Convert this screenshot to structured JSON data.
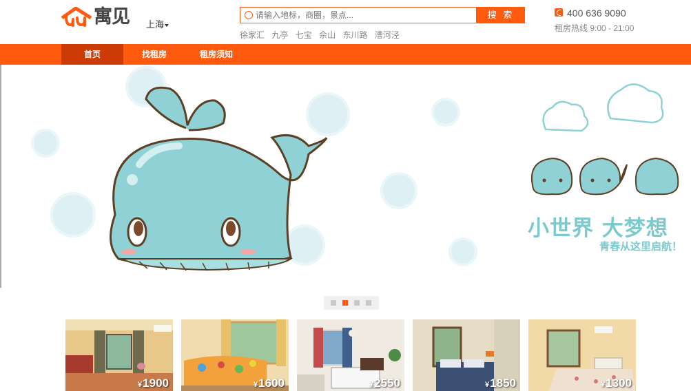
{
  "brand": {
    "name": "寓见",
    "accent": "#ff5a0e"
  },
  "header": {
    "city": "上海",
    "search": {
      "placeholder": "请输入地标，商圈，景点...",
      "button": "搜 索"
    },
    "hot_links": [
      "徐家汇",
      "九亭",
      "七宝",
      "佘山",
      "东川路",
      "漕河泾"
    ],
    "hotline": {
      "number": "400 636 9090",
      "hours": "租房热线  9:00 - 21:00"
    }
  },
  "nav": {
    "items": [
      {
        "label": "首页",
        "active": true
      },
      {
        "label": "找租房",
        "active": false
      },
      {
        "label": "租房须知",
        "active": false
      }
    ]
  },
  "banner": {
    "slogan_main": "小世界 大梦想",
    "slogan_sub": "青春从这里启航！",
    "slides": 4,
    "active_slide": 2
  },
  "listings": [
    {
      "price": "1900",
      "currency": "¥"
    },
    {
      "price": "1600",
      "currency": "¥"
    },
    {
      "price": "2550",
      "currency": "¥"
    },
    {
      "price": "1850",
      "currency": "¥"
    },
    {
      "price": "1300",
      "currency": "¥"
    }
  ]
}
